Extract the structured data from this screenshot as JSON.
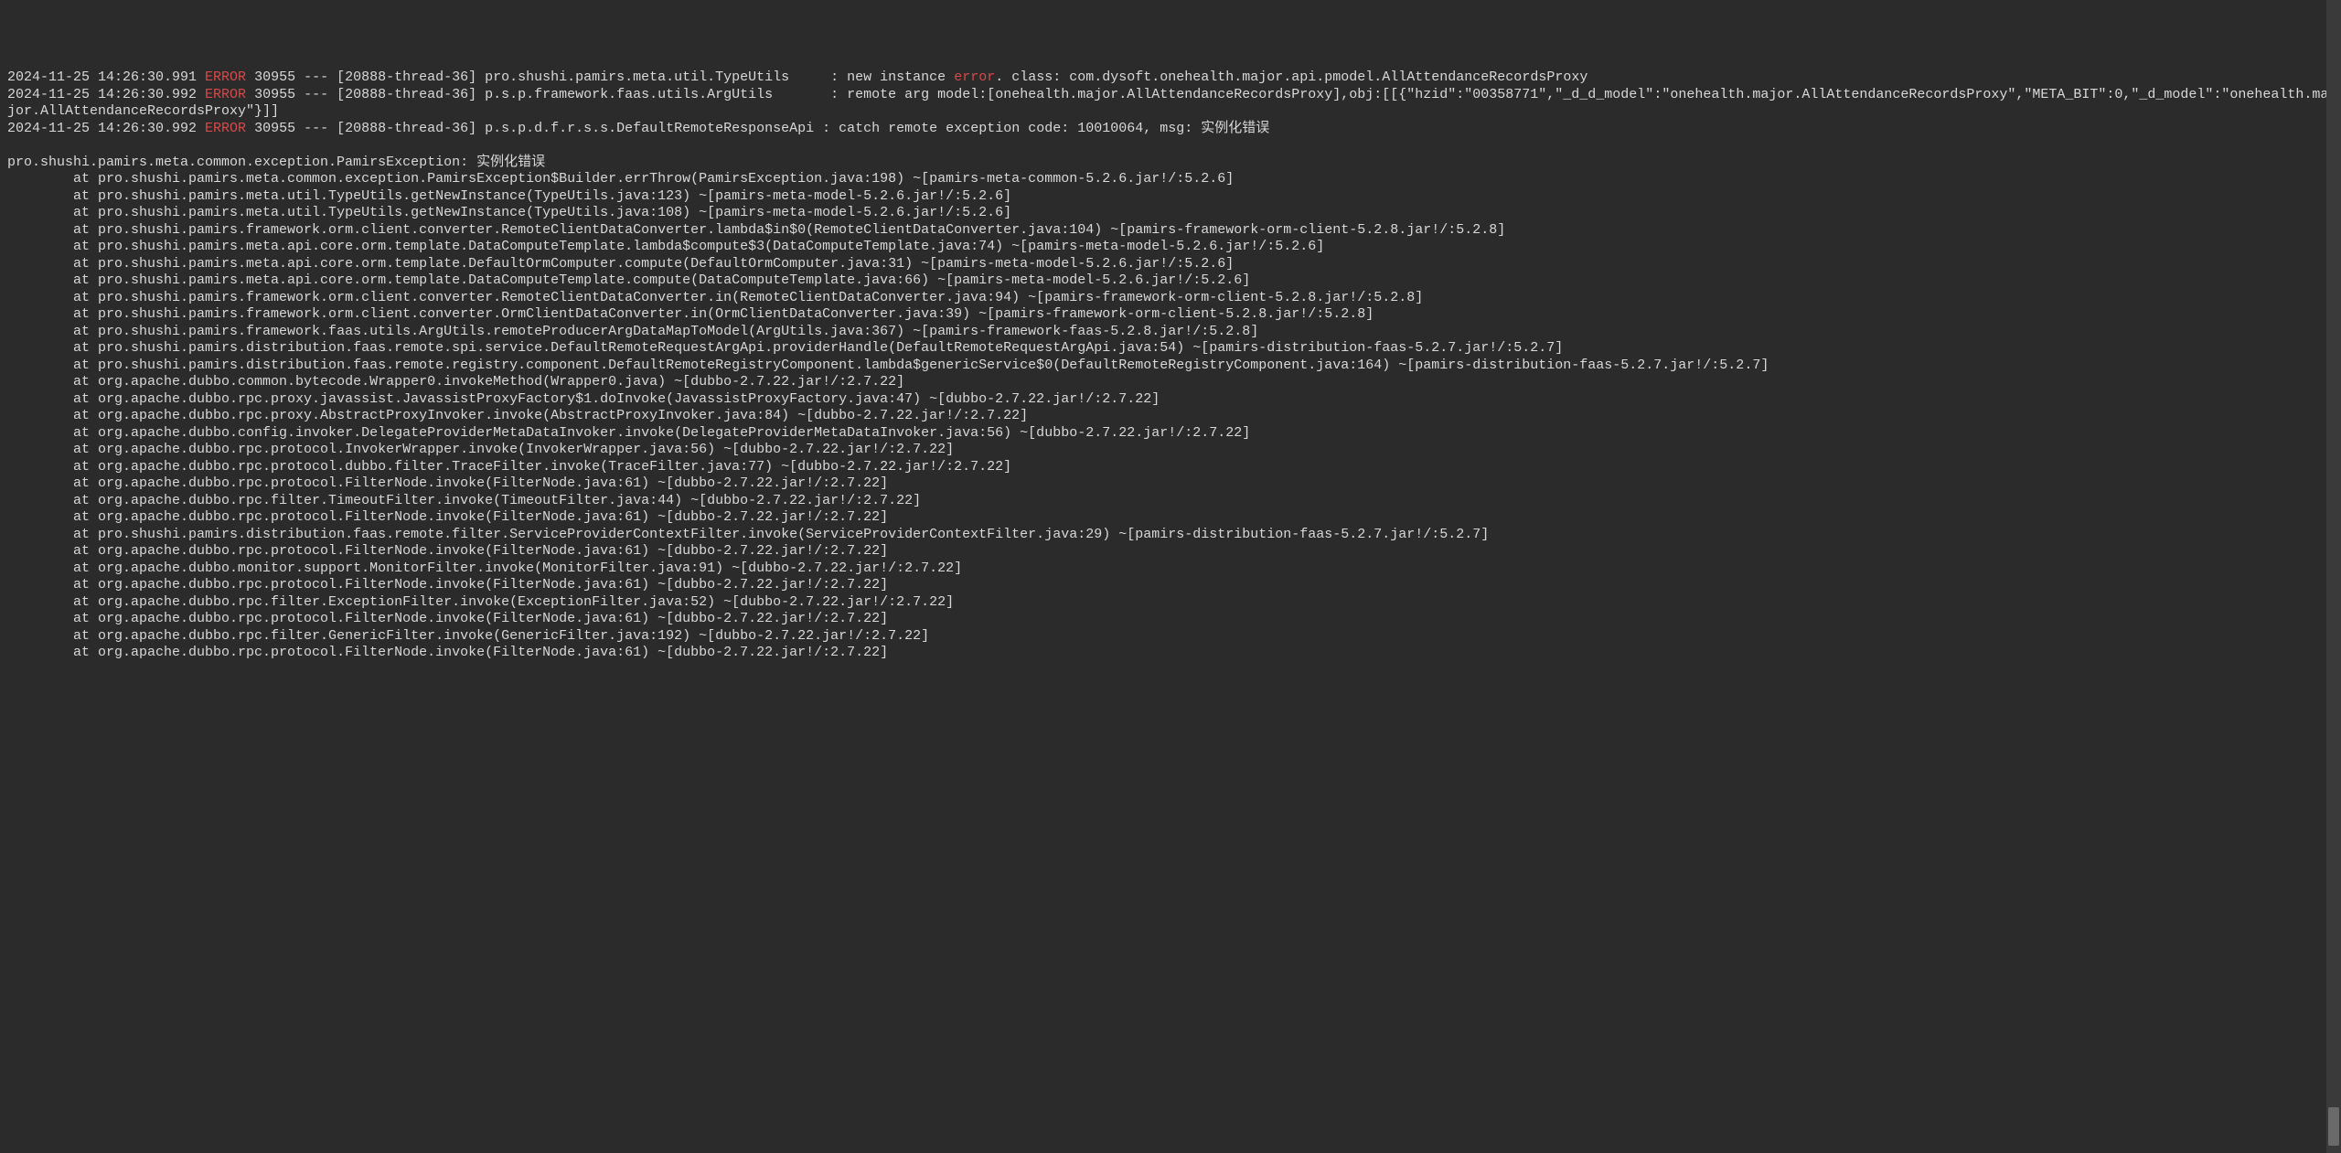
{
  "logLines": [
    {
      "segments": [
        {
          "text": "2024-11-25 14:26:30.991 ",
          "class": ""
        },
        {
          "text": "ERROR",
          "class": "error-tag"
        },
        {
          "text": " 30955 --- [20888-thread-36] pro.shushi.pamirs.meta.util.TypeUtils     : new instance ",
          "class": ""
        },
        {
          "text": "error",
          "class": "error-tag"
        },
        {
          "text": ". class: com.dysoft.onehealth.major.api.pmodel.AllAttendanceRecordsProxy",
          "class": ""
        }
      ]
    },
    {
      "segments": [
        {
          "text": "2024-11-25 14:26:30.992 ",
          "class": ""
        },
        {
          "text": "ERROR",
          "class": "error-tag"
        },
        {
          "text": " 30955 --- [20888-thread-36] p.s.p.framework.faas.utils.ArgUtils       : remote arg model:[onehealth.major.AllAttendanceRecordsProxy],obj:[[{\"hzid\":\"00358771\",\"_d_d_model\":\"onehealth.major.AllAttendanceRecordsProxy\",\"META_BIT\":0,\"_d_model\":\"onehealth.major.AllAttendanceRecordsProxy\"}]]",
          "class": ""
        }
      ]
    },
    {
      "segments": [
        {
          "text": "2024-11-25 14:26:30.992 ",
          "class": ""
        },
        {
          "text": "ERROR",
          "class": "error-tag"
        },
        {
          "text": " 30955 --- [20888-thread-36] p.s.p.d.f.r.s.s.DefaultRemoteResponseApi : catch remote exception code: 10010064, msg: 实例化错误",
          "class": ""
        }
      ]
    },
    {
      "segments": [
        {
          "text": "",
          "class": ""
        }
      ]
    },
    {
      "segments": [
        {
          "text": "pro.shushi.pamirs.meta.common.exception.PamirsException: 实例化错误",
          "class": ""
        }
      ]
    },
    {
      "segments": [
        {
          "text": "        at pro.shushi.pamirs.meta.common.exception.PamirsException$Builder.errThrow(PamirsException.java:198) ~[pamirs-meta-common-5.2.6.jar!/:5.2.6]",
          "class": ""
        }
      ]
    },
    {
      "segments": [
        {
          "text": "        at pro.shushi.pamirs.meta.util.TypeUtils.getNewInstance(TypeUtils.java:123) ~[pamirs-meta-model-5.2.6.jar!/:5.2.6]",
          "class": ""
        }
      ]
    },
    {
      "segments": [
        {
          "text": "        at pro.shushi.pamirs.meta.util.TypeUtils.getNewInstance(TypeUtils.java:108) ~[pamirs-meta-model-5.2.6.jar!/:5.2.6]",
          "class": ""
        }
      ]
    },
    {
      "segments": [
        {
          "text": "        at pro.shushi.pamirs.framework.orm.client.converter.RemoteClientDataConverter.lambda$in$0(RemoteClientDataConverter.java:104) ~[pamirs-framework-orm-client-5.2.8.jar!/:5.2.8]",
          "class": ""
        }
      ]
    },
    {
      "segments": [
        {
          "text": "        at pro.shushi.pamirs.meta.api.core.orm.template.DataComputeTemplate.lambda$compute$3(DataComputeTemplate.java:74) ~[pamirs-meta-model-5.2.6.jar!/:5.2.6]",
          "class": ""
        }
      ]
    },
    {
      "segments": [
        {
          "text": "        at pro.shushi.pamirs.meta.api.core.orm.template.DefaultOrmComputer.compute(DefaultOrmComputer.java:31) ~[pamirs-meta-model-5.2.6.jar!/:5.2.6]",
          "class": ""
        }
      ]
    },
    {
      "segments": [
        {
          "text": "        at pro.shushi.pamirs.meta.api.core.orm.template.DataComputeTemplate.compute(DataComputeTemplate.java:66) ~[pamirs-meta-model-5.2.6.jar!/:5.2.6]",
          "class": ""
        }
      ]
    },
    {
      "segments": [
        {
          "text": "        at pro.shushi.pamirs.framework.orm.client.converter.RemoteClientDataConverter.in(RemoteClientDataConverter.java:94) ~[pamirs-framework-orm-client-5.2.8.jar!/:5.2.8]",
          "class": ""
        }
      ]
    },
    {
      "segments": [
        {
          "text": "        at pro.shushi.pamirs.framework.orm.client.converter.OrmClientDataConverter.in(OrmClientDataConverter.java:39) ~[pamirs-framework-orm-client-5.2.8.jar!/:5.2.8]",
          "class": ""
        }
      ]
    },
    {
      "segments": [
        {
          "text": "        at pro.shushi.pamirs.framework.faas.utils.ArgUtils.remoteProducerArgDataMapToModel(ArgUtils.java:367) ~[pamirs-framework-faas-5.2.8.jar!/:5.2.8]",
          "class": ""
        }
      ]
    },
    {
      "segments": [
        {
          "text": "        at pro.shushi.pamirs.distribution.faas.remote.spi.service.DefaultRemoteRequestArgApi.providerHandle(DefaultRemoteRequestArgApi.java:54) ~[pamirs-distribution-faas-5.2.7.jar!/:5.2.7]",
          "class": ""
        }
      ]
    },
    {
      "segments": [
        {
          "text": "        at pro.shushi.pamirs.distribution.faas.remote.registry.component.DefaultRemoteRegistryComponent.lambda$genericService$0(DefaultRemoteRegistryComponent.java:164) ~[pamirs-distribution-faas-5.2.7.jar!/:5.2.7]",
          "class": ""
        }
      ]
    },
    {
      "segments": [
        {
          "text": "        at org.apache.dubbo.common.bytecode.Wrapper0.invokeMethod(Wrapper0.java) ~[dubbo-2.7.22.jar!/:2.7.22]",
          "class": ""
        }
      ]
    },
    {
      "segments": [
        {
          "text": "        at org.apache.dubbo.rpc.proxy.javassist.JavassistProxyFactory$1.doInvoke(JavassistProxyFactory.java:47) ~[dubbo-2.7.22.jar!/:2.7.22]",
          "class": ""
        }
      ]
    },
    {
      "segments": [
        {
          "text": "        at org.apache.dubbo.rpc.proxy.AbstractProxyInvoker.invoke(AbstractProxyInvoker.java:84) ~[dubbo-2.7.22.jar!/:2.7.22]",
          "class": ""
        }
      ]
    },
    {
      "segments": [
        {
          "text": "        at org.apache.dubbo.config.invoker.DelegateProviderMetaDataInvoker.invoke(DelegateProviderMetaDataInvoker.java:56) ~[dubbo-2.7.22.jar!/:2.7.22]",
          "class": ""
        }
      ]
    },
    {
      "segments": [
        {
          "text": "        at org.apache.dubbo.rpc.protocol.InvokerWrapper.invoke(InvokerWrapper.java:56) ~[dubbo-2.7.22.jar!/:2.7.22]",
          "class": ""
        }
      ]
    },
    {
      "segments": [
        {
          "text": "        at org.apache.dubbo.rpc.protocol.dubbo.filter.TraceFilter.invoke(TraceFilter.java:77) ~[dubbo-2.7.22.jar!/:2.7.22]",
          "class": ""
        }
      ]
    },
    {
      "segments": [
        {
          "text": "        at org.apache.dubbo.rpc.protocol.FilterNode.invoke(FilterNode.java:61) ~[dubbo-2.7.22.jar!/:2.7.22]",
          "class": ""
        }
      ]
    },
    {
      "segments": [
        {
          "text": "        at org.apache.dubbo.rpc.filter.TimeoutFilter.invoke(TimeoutFilter.java:44) ~[dubbo-2.7.22.jar!/:2.7.22]",
          "class": ""
        }
      ]
    },
    {
      "segments": [
        {
          "text": "        at org.apache.dubbo.rpc.protocol.FilterNode.invoke(FilterNode.java:61) ~[dubbo-2.7.22.jar!/:2.7.22]",
          "class": ""
        }
      ]
    },
    {
      "segments": [
        {
          "text": "        at pro.shushi.pamirs.distribution.faas.remote.filter.ServiceProviderContextFilter.invoke(ServiceProviderContextFilter.java:29) ~[pamirs-distribution-faas-5.2.7.jar!/:5.2.7]",
          "class": ""
        }
      ]
    },
    {
      "segments": [
        {
          "text": "        at org.apache.dubbo.rpc.protocol.FilterNode.invoke(FilterNode.java:61) ~[dubbo-2.7.22.jar!/:2.7.22]",
          "class": ""
        }
      ]
    },
    {
      "segments": [
        {
          "text": "        at org.apache.dubbo.monitor.support.MonitorFilter.invoke(MonitorFilter.java:91) ~[dubbo-2.7.22.jar!/:2.7.22]",
          "class": ""
        }
      ]
    },
    {
      "segments": [
        {
          "text": "        at org.apache.dubbo.rpc.protocol.FilterNode.invoke(FilterNode.java:61) ~[dubbo-2.7.22.jar!/:2.7.22]",
          "class": ""
        }
      ]
    },
    {
      "segments": [
        {
          "text": "        at org.apache.dubbo.rpc.filter.ExceptionFilter.invoke(ExceptionFilter.java:52) ~[dubbo-2.7.22.jar!/:2.7.22]",
          "class": ""
        }
      ]
    },
    {
      "segments": [
        {
          "text": "        at org.apache.dubbo.rpc.protocol.FilterNode.invoke(FilterNode.java:61) ~[dubbo-2.7.22.jar!/:2.7.22]",
          "class": ""
        }
      ]
    },
    {
      "segments": [
        {
          "text": "        at org.apache.dubbo.rpc.filter.GenericFilter.invoke(GenericFilter.java:192) ~[dubbo-2.7.22.jar!/:2.7.22]",
          "class": ""
        }
      ]
    },
    {
      "segments": [
        {
          "text": "        at org.apache.dubbo.rpc.protocol.FilterNode.invoke(FilterNode.java:61) ~[dubbo-2.7.22.jar!/:2.7.22]",
          "class": ""
        }
      ]
    }
  ]
}
